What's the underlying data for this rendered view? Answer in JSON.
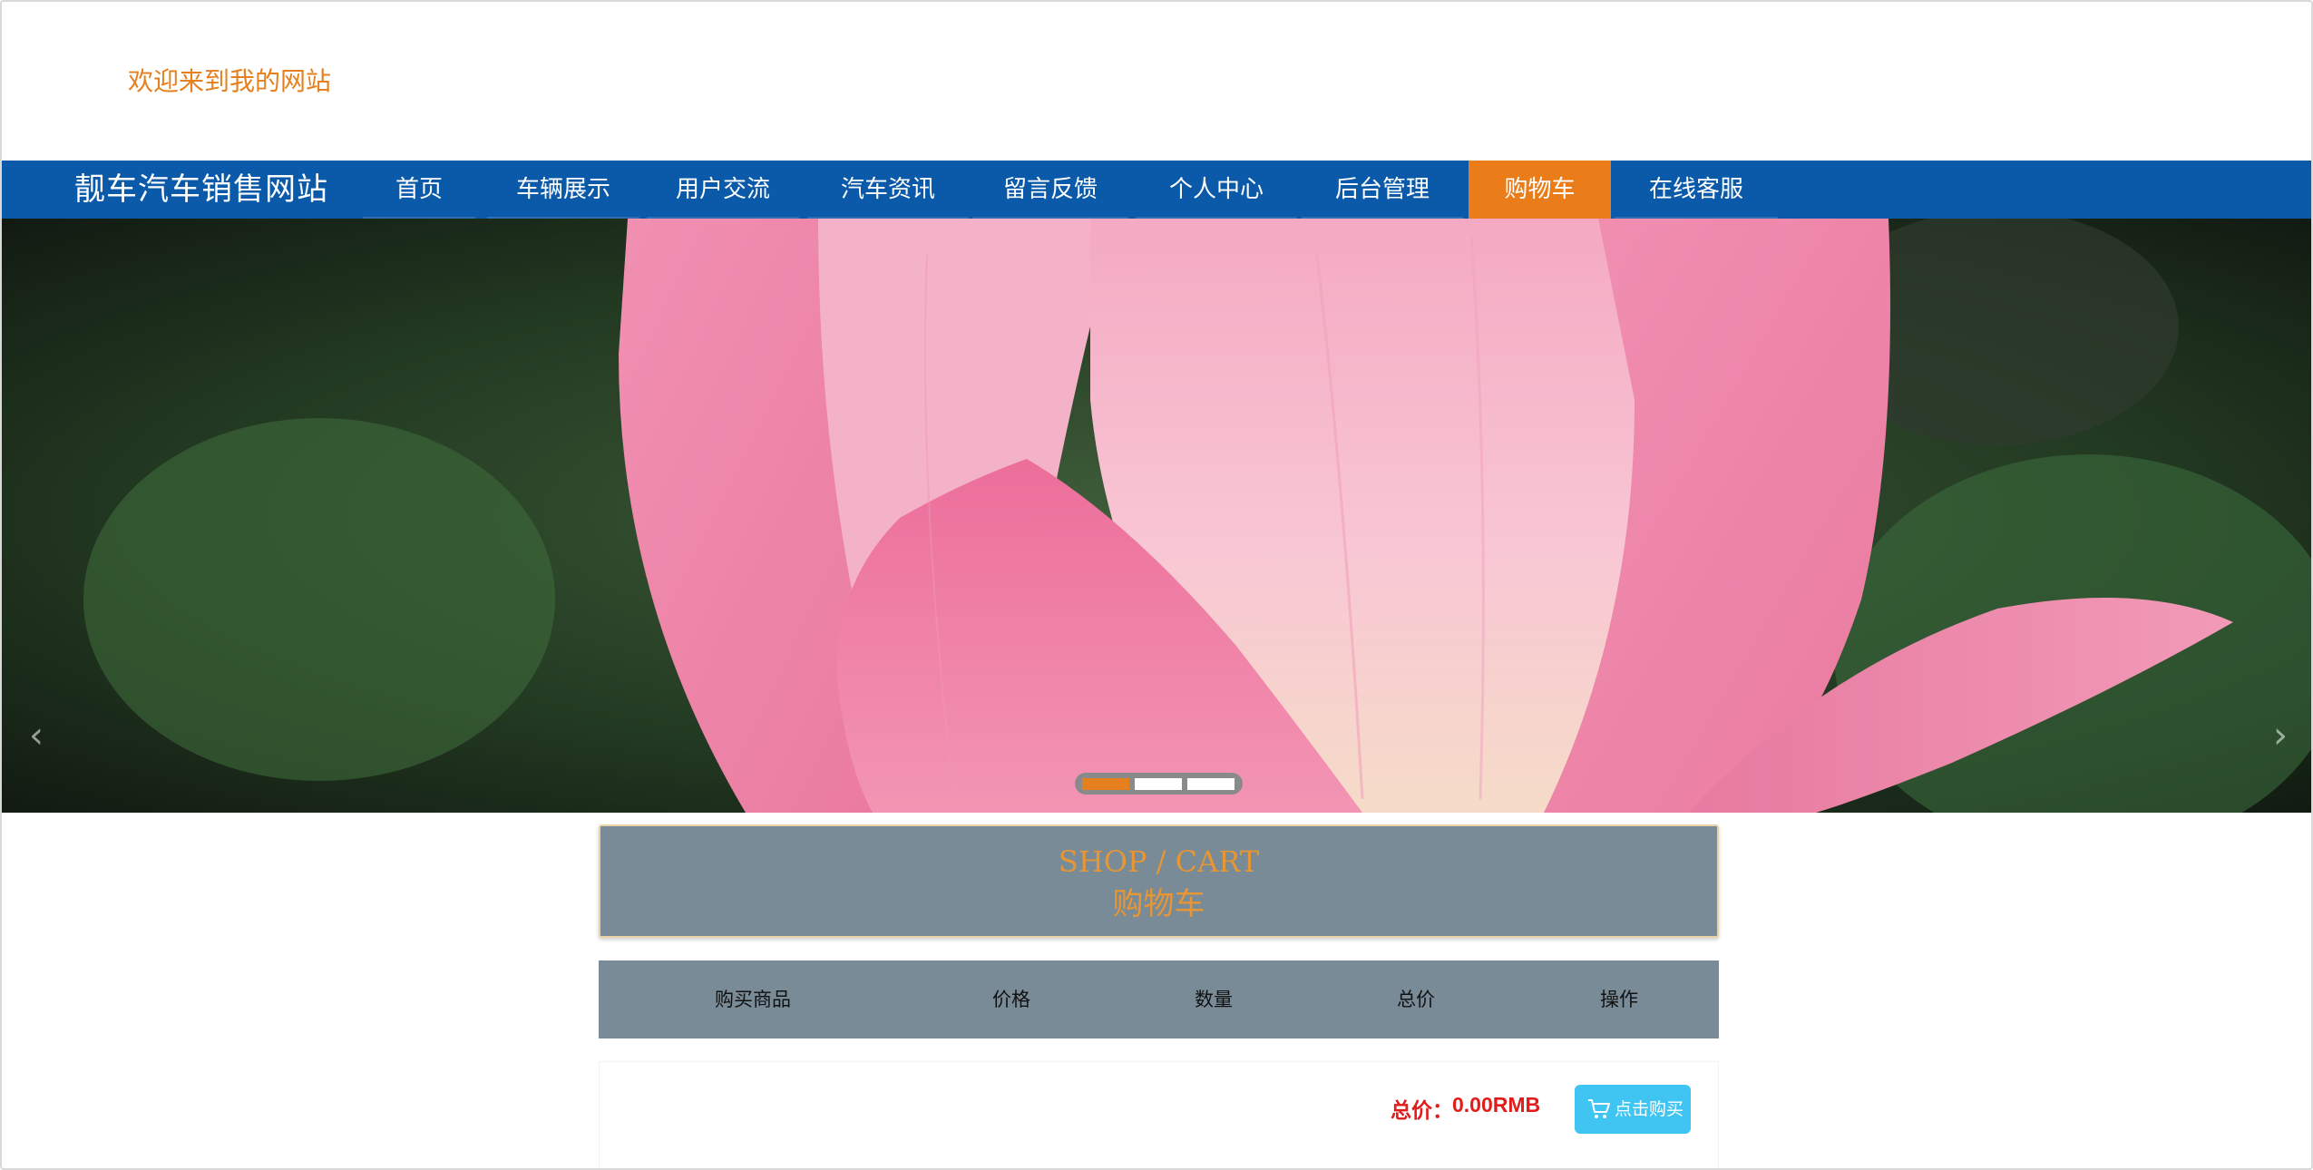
{
  "header": {
    "welcome": "欢迎来到我的网站"
  },
  "nav": {
    "site_title": "靓车汽车销售网站",
    "items": [
      {
        "label": "首页"
      },
      {
        "label": "车辆展示"
      },
      {
        "label": "用户交流"
      },
      {
        "label": "汽车资讯"
      },
      {
        "label": "留言反馈"
      },
      {
        "label": "个人中心"
      },
      {
        "label": "后台管理"
      },
      {
        "label": "购物车",
        "active": true
      },
      {
        "label": "在线客服"
      }
    ]
  },
  "banner": {
    "prev_glyph": "‹",
    "next_glyph": "›",
    "slide_count": 3,
    "active_slide": 1
  },
  "cart": {
    "title_en": "SHOP / CART",
    "title_zh": "购物车",
    "columns": [
      "购买商品",
      "价格",
      "数量",
      "总价",
      "操作"
    ],
    "rows": [],
    "total_label": "总价：",
    "total_value": "0.00RMB",
    "buy_label": "点击购买"
  },
  "colors": {
    "nav_bg": "#0a5aa9",
    "nav_active": "#ea7d1a",
    "accent_orange": "#e6801e",
    "panel_grey": "#788b97",
    "total_red": "#e21b1b",
    "buy_blue": "#40c4f1"
  }
}
